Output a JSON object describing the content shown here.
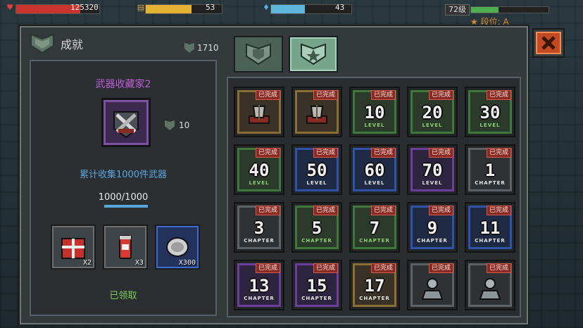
{
  "hud": {
    "hp": "125320",
    "gold": "53",
    "energy": "43",
    "level": "72级",
    "rank_label": "段位: A",
    "hp_fill": 0.77,
    "gold_fill": 0.6,
    "energy_fill": 0.42,
    "level_fill": 0.35
  },
  "panel": {
    "title": "成就",
    "points": "1710"
  },
  "detail": {
    "name": "武器收藏家2",
    "reward_points": "10",
    "description": "累计收集1000件武器",
    "progress_text": "1000/1000",
    "progress_fill": 1.0,
    "rewards": [
      {
        "icon": "red-gift-box-icon",
        "qty": "X2"
      },
      {
        "icon": "soda-can-icon",
        "qty": "X3"
      },
      {
        "icon": "silver-coin-icon",
        "qty": "X300"
      }
    ],
    "status": "已领取"
  },
  "done_label": "已完成",
  "grid": [
    {
      "style": "gold",
      "kind": "emblem",
      "icon": "axe-banner-icon",
      "done": true
    },
    {
      "style": "gold",
      "kind": "emblem",
      "icon": "hammer-banner-icon",
      "done": true
    },
    {
      "style": "green",
      "kind": "number",
      "num": "10",
      "label": "LEVEL",
      "done": true
    },
    {
      "style": "green",
      "kind": "number",
      "num": "20",
      "label": "LEVEL",
      "done": true
    },
    {
      "style": "green",
      "kind": "number",
      "num": "30",
      "label": "LEVEL",
      "done": true
    },
    {
      "style": "green",
      "kind": "number",
      "num": "40",
      "label": "LEVEL",
      "done": true
    },
    {
      "style": "blue",
      "kind": "number",
      "num": "50",
      "label": "LEVEL",
      "done": true
    },
    {
      "style": "blue",
      "kind": "number",
      "num": "60",
      "label": "LEVEL",
      "done": true
    },
    {
      "style": "purple",
      "kind": "number",
      "num": "70",
      "label": "LEVEL",
      "done": true
    },
    {
      "style": "gray",
      "kind": "number",
      "num": "1",
      "label": "CHAPTER",
      "done": true
    },
    {
      "style": "gray",
      "kind": "number",
      "num": "3",
      "label": "CHAPTER",
      "done": true
    },
    {
      "style": "green",
      "kind": "number",
      "num": "5",
      "label": "CHAPTER",
      "done": true
    },
    {
      "style": "green",
      "kind": "number",
      "num": "7",
      "label": "CHAPTER",
      "done": true
    },
    {
      "style": "blue",
      "kind": "number",
      "num": "9",
      "label": "CHAPTER",
      "done": true
    },
    {
      "style": "blue",
      "kind": "number",
      "num": "11",
      "label": "CHAPTER",
      "done": true
    },
    {
      "style": "purple",
      "kind": "number",
      "num": "13",
      "label": "CHAPTER",
      "done": true
    },
    {
      "style": "purple",
      "kind": "number",
      "num": "15",
      "label": "CHAPTER",
      "done": true
    },
    {
      "style": "gold",
      "kind": "number",
      "num": "17",
      "label": "CHAPTER",
      "done": true
    },
    {
      "style": "gray",
      "kind": "emblem",
      "icon": "hero-bust-icon",
      "done": true
    },
    {
      "style": "gray",
      "kind": "emblem",
      "icon": "hero-bust-icon",
      "done": true
    }
  ]
}
